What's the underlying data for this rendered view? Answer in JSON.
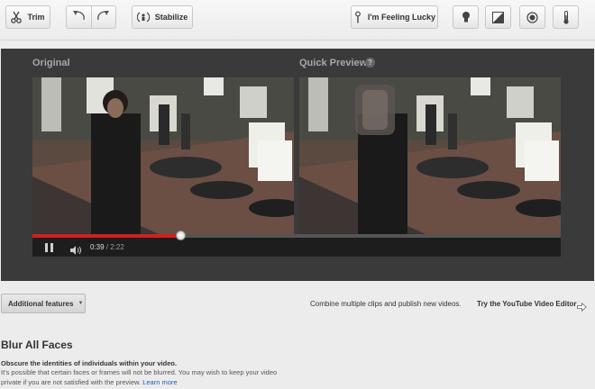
{
  "toolbar": {
    "trim_label": "Trim",
    "stabilize_label": "Stabilize",
    "lucky_label": "I'm Feeling Lucky",
    "icons": [
      "scissors-icon",
      "rotate-left-icon",
      "rotate-right-icon",
      "stabilize-icon",
      "wand-icon",
      "bulb-icon",
      "contrast-icon",
      "saturation-icon",
      "thermometer-icon"
    ]
  },
  "preview": {
    "original_label": "Original",
    "quick_preview_label": "Quick Preview",
    "help_glyph": "?",
    "player": {
      "progress_fraction": 0.28,
      "current_time": "0:39",
      "separator": " / ",
      "duration": "2:22"
    }
  },
  "features": {
    "additional_label": "Additional features",
    "combine_text": "Combine multiple clips and publish new videos.",
    "editor_link": "Try the YouTube Video Editor"
  },
  "blur": {
    "title": "Blur All Faces",
    "heading": "Obscure the identities of individuals within your video.",
    "body": "It's possible that certain faces or frames will not be blurred. You may wish to keep your video private if you are not satisfied with the preview.",
    "learn_more": "Learn more"
  },
  "colors": {
    "accent_red": "#d01f1f",
    "link_blue": "#1b5fb3",
    "panel_bg": "#3a3a3a"
  }
}
